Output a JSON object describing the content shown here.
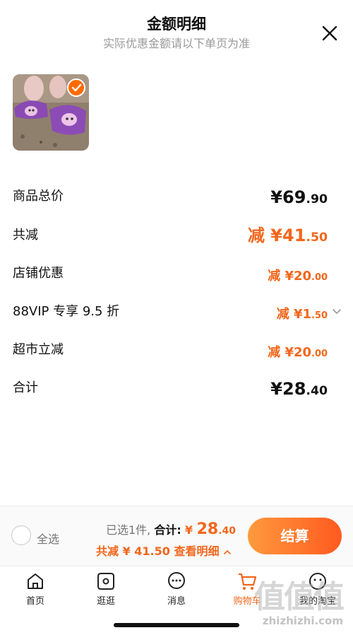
{
  "header": {
    "title": "金额明细",
    "subtitle": "实际优惠金额请以下单页为准"
  },
  "price_rows": [
    {
      "label": "商品总价",
      "prefix": "",
      "currency": "¥",
      "int": "69",
      "dec": ".90"
    },
    {
      "label": "共减",
      "prefix": "减 ",
      "currency": "¥",
      "int": "41",
      "dec": ".50"
    },
    {
      "label": "店铺优惠",
      "prefix": "减 ",
      "currency": "¥",
      "int": "20",
      "dec": ".00"
    },
    {
      "label": "88VIP 专享 9.5 折",
      "prefix": "减 ",
      "currency": "¥",
      "int": "1",
      "dec": ".50"
    },
    {
      "label": "超市立减",
      "prefix": "减 ",
      "currency": "¥",
      "int": "20",
      "dec": ".00"
    },
    {
      "label": "合计",
      "prefix": "",
      "currency": "¥",
      "int": "28",
      "dec": ".40"
    }
  ],
  "bottom": {
    "select_all": "全选",
    "selected_count": "已选1件,",
    "total_label": "合计:",
    "total_currency": "¥",
    "total_int": "28",
    "total_dec": ".40",
    "discount_text": "共减 ¥ 41.50 查看明细",
    "checkout": "结算"
  },
  "tabs": [
    {
      "label": "首页",
      "icon": "home-icon"
    },
    {
      "label": "逛逛",
      "icon": "explore-icon"
    },
    {
      "label": "消息",
      "icon": "message-icon"
    },
    {
      "label": "购物车",
      "icon": "cart-icon"
    },
    {
      "label": "我的淘宝",
      "icon": "profile-icon"
    }
  ],
  "watermark": {
    "mark": "值值值",
    "domain": "zhizhizhi.com"
  },
  "colors": {
    "accent": "#f2661b",
    "checkout_start": "#ff9a3d",
    "checkout_end": "#ff5a1f"
  }
}
